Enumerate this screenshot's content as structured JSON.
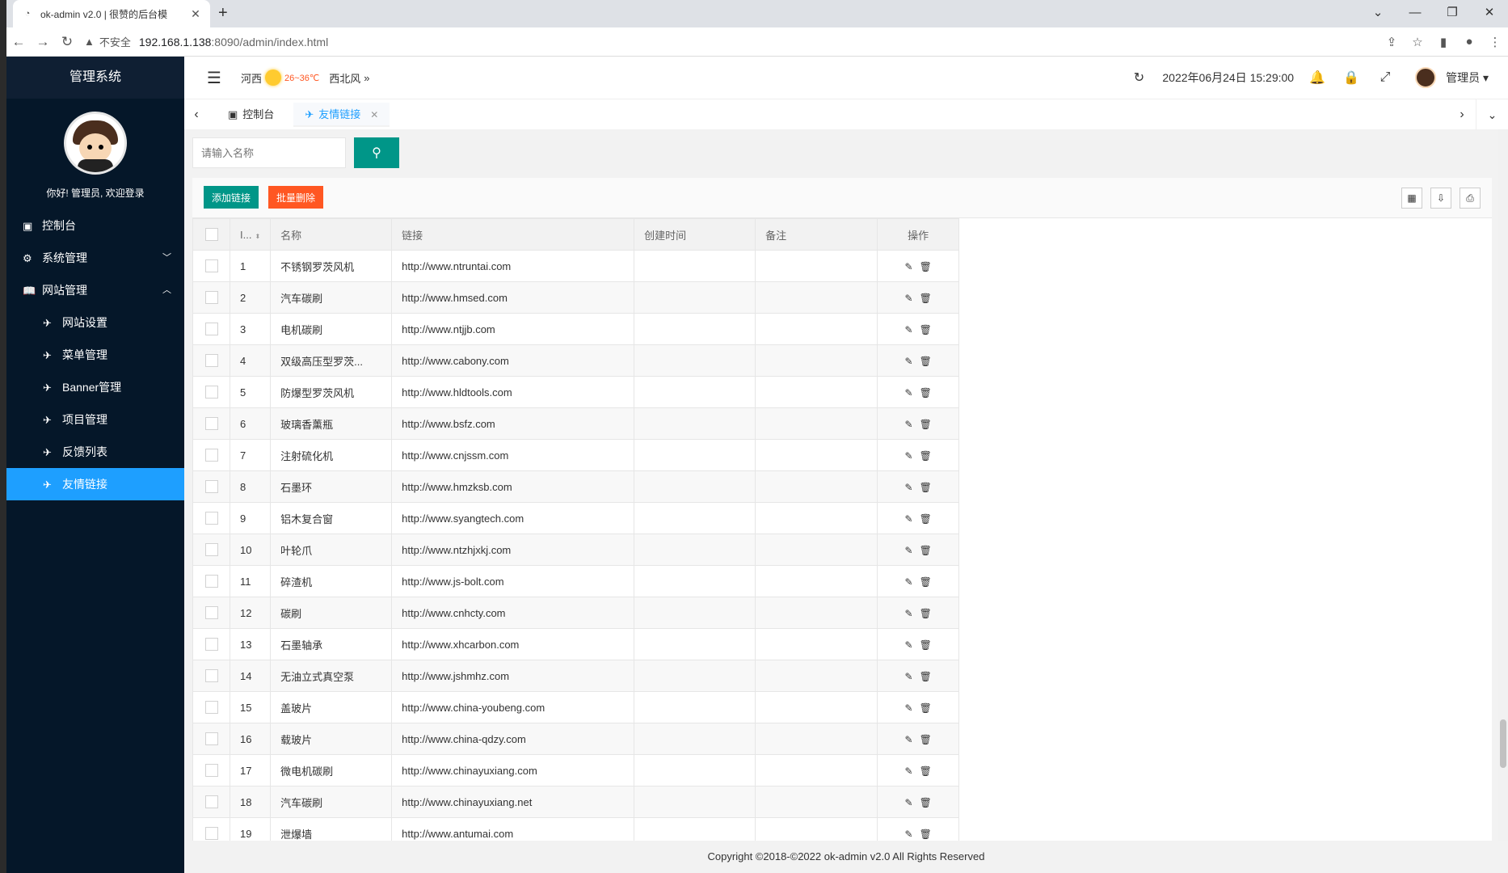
{
  "browser": {
    "tab_title": "ok-admin v2.0 | 很赞的后台模",
    "new_tab": "+",
    "address_insecure": "不安全",
    "address_host": "192.168.1.138",
    "address_path": ":8090/admin/index.html"
  },
  "sidebar": {
    "title": "管理系统",
    "welcome": "你好! 管理员, 欢迎登录",
    "items": [
      {
        "label": "控制台",
        "icon": "monitor-icon"
      },
      {
        "label": "系统管理",
        "icon": "gear-icon",
        "expanded": false
      },
      {
        "label": "网站管理",
        "icon": "book-icon",
        "expanded": true
      },
      {
        "label": "网站设置",
        "icon": "link-icon"
      },
      {
        "label": "菜单管理",
        "icon": "link-icon"
      },
      {
        "label": "Banner管理",
        "icon": "link-icon"
      },
      {
        "label": "项目管理",
        "icon": "link-icon"
      },
      {
        "label": "反馈列表",
        "icon": "link-icon"
      },
      {
        "label": "友情链接",
        "icon": "link-icon",
        "active": true
      }
    ]
  },
  "header": {
    "city": "河西",
    "temp": "26~36℃",
    "wind": "西北风",
    "datetime": "2022年06月24日 15:29:00",
    "user": "管理员"
  },
  "tabs": [
    {
      "label": "控制台",
      "active": false
    },
    {
      "label": "友情链接",
      "active": true
    }
  ],
  "search": {
    "placeholder": "请输入名称"
  },
  "toolbar": {
    "add": "添加链接",
    "batch_delete": "批量删除"
  },
  "table": {
    "headers": [
      "I...",
      "名称",
      "链接",
      "创建时间",
      "备注",
      "操作"
    ],
    "rows": [
      {
        "id": "1",
        "name": "不锈钢罗茨风机",
        "url": "http://www.ntruntai.com"
      },
      {
        "id": "2",
        "name": "汽车碳刷",
        "url": "http://www.hmsed.com"
      },
      {
        "id": "3",
        "name": "电机碳刷",
        "url": "http://www.ntjjb.com"
      },
      {
        "id": "4",
        "name": "双级高压型罗茨...",
        "url": "http://www.cabony.com"
      },
      {
        "id": "5",
        "name": "防爆型罗茨风机",
        "url": "http://www.hldtools.com"
      },
      {
        "id": "6",
        "name": "玻璃香薰瓶",
        "url": "http://www.bsfz.com"
      },
      {
        "id": "7",
        "name": "注射硫化机",
        "url": "http://www.cnjssm.com"
      },
      {
        "id": "8",
        "name": "石墨环",
        "url": "http://www.hmzksb.com"
      },
      {
        "id": "9",
        "name": "铝木复合窗",
        "url": "http://www.syangtech.com"
      },
      {
        "id": "10",
        "name": "叶轮爪",
        "url": "http://www.ntzhjxkj.com"
      },
      {
        "id": "11",
        "name": "碎渣机",
        "url": "http://www.js-bolt.com"
      },
      {
        "id": "12",
        "name": "碳刷",
        "url": "http://www.cnhcty.com"
      },
      {
        "id": "13",
        "name": "石墨轴承",
        "url": "http://www.xhcarbon.com"
      },
      {
        "id": "14",
        "name": "无油立式真空泵",
        "url": "http://www.jshmhz.com"
      },
      {
        "id": "15",
        "name": "盖玻片",
        "url": "http://www.china-youbeng.com"
      },
      {
        "id": "16",
        "name": "载玻片",
        "url": "http://www.china-qdzy.com"
      },
      {
        "id": "17",
        "name": "微电机碳刷",
        "url": "http://www.chinayuxiang.com"
      },
      {
        "id": "18",
        "name": "汽车碳刷",
        "url": "http://www.chinayuxiang.net"
      },
      {
        "id": "19",
        "name": "泄爆墙",
        "url": "http://www.antumai.com"
      }
    ]
  },
  "footer": "Copyright ©2018-©2022 ok-admin v2.0 All Rights Reserved",
  "colors": {
    "sidebar_bg": "#051729",
    "active": "#1e9fff",
    "primary": "#009688",
    "danger": "#ff5722"
  }
}
